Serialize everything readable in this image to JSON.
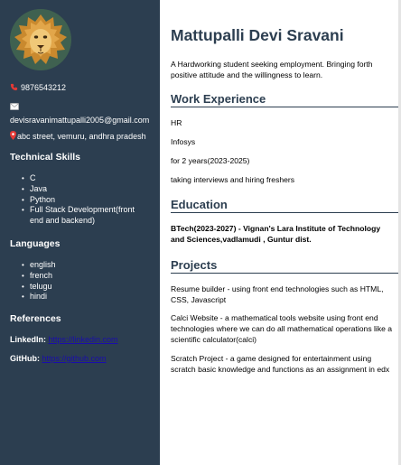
{
  "sidebar": {
    "phone": "9876543212",
    "email": "devisravanimattupalli2005@gmail.com",
    "address": "abc street, vemuru, andhra pradesh",
    "skills_heading": "Technical Skills",
    "skills": [
      "C",
      "Java",
      "Python",
      "Full Stack Development(front end and backend)"
    ],
    "languages_heading": "Languages",
    "languages": [
      "english",
      "french",
      "telugu",
      "hindi"
    ],
    "references_heading": "References",
    "references": [
      {
        "label": "LinkedIn:",
        "link": "https://linkedin.com"
      },
      {
        "label": "GitHub:",
        "link": "https://github.com"
      }
    ]
  },
  "main": {
    "name": "Mattupalli Devi Sravani",
    "intro": "A Hardworking student seeking employment. Bringing forth positive attitude and the willingness to learn.",
    "experience_heading": "Work Experience",
    "experience": [
      "HR",
      "Infosys",
      "for 2 years(2023-2025)",
      "taking interviews and hiring freshers"
    ],
    "education_heading": "Education",
    "education_line1": "BTech(2023-2027) - Vignan's Lara Institute of Technology",
    "education_line2": "and Sciences,vadlamudi , Guntur dist.",
    "projects_heading": "Projects",
    "projects": [
      "Resume builder - using front end technologies such as HTML, CSS, Javascript",
      "Calci Website - a mathematical tools website using front end technologies where we can do all mathematical operations like a scientific calculator(calci)",
      "Scratch Project - a game designed for entertainment using scratch basic knowledge and functions as an assignment in edx"
    ]
  },
  "colors": {
    "sidebar_bg": "#2c3e50",
    "heading": "#2c3e50",
    "link": "#1a0dab"
  },
  "icons": [
    "lion-avatar",
    "phone-icon",
    "email-icon",
    "location-pin-icon"
  ]
}
